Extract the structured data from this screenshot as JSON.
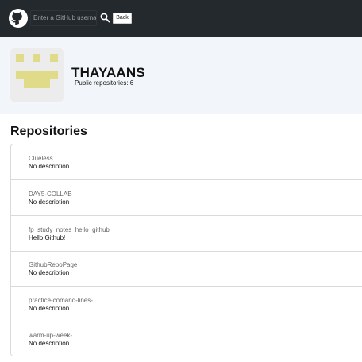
{
  "header": {
    "search_placeholder": "Enter a GitHub userna...",
    "back_label": "Back",
    "colors": {
      "background": "#24292e"
    }
  },
  "profile": {
    "username": "THAYAANS",
    "public_repos_text": "Public repositories: 6",
    "avatar_color": "#e0db88"
  },
  "repositories": {
    "title": "Repositories",
    "items": [
      {
        "name": "Clueless",
        "description": "No description"
      },
      {
        "name": "DAY5-COLLAB",
        "description": "No description"
      },
      {
        "name": "fp_study_notes_hello_github",
        "description": "Hello Github!"
      },
      {
        "name": "GithubRepoPage",
        "description": "No description"
      },
      {
        "name": "practice-comand-lines-",
        "description": "No description"
      },
      {
        "name": "warm-up-week-",
        "description": "No description"
      }
    ]
  },
  "icons": {
    "logo": "github-logo-icon",
    "search": "search-icon"
  }
}
